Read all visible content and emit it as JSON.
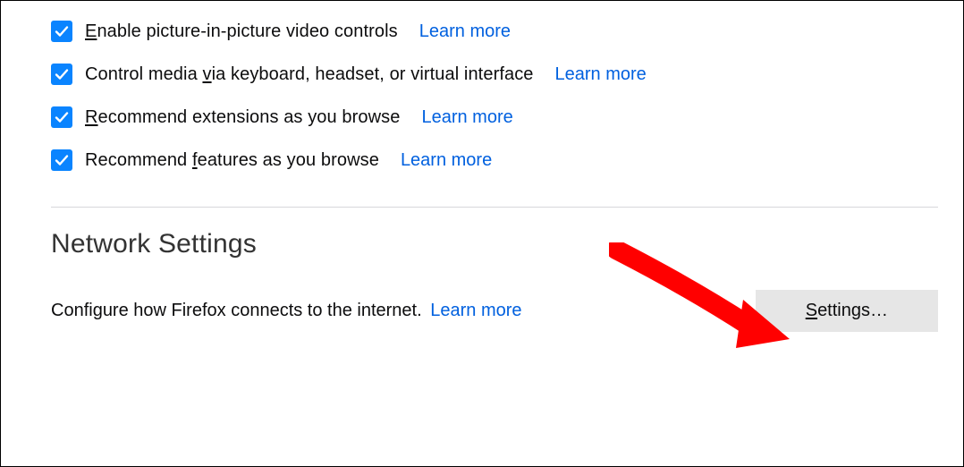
{
  "browsing": {
    "options": [
      {
        "pre": "",
        "accel": "E",
        "post": "nable picture-in-picture video controls",
        "learn_more": "Learn more"
      },
      {
        "pre": "Control media ",
        "accel": "v",
        "post": "ia keyboard, headset, or virtual interface",
        "learn_more": "Learn more"
      },
      {
        "pre": "",
        "accel": "R",
        "post": "ecommend extensions as you browse",
        "learn_more": "Learn more"
      },
      {
        "pre": "Recommend ",
        "accel": "f",
        "post": "eatures as you browse",
        "learn_more": "Learn more"
      }
    ]
  },
  "network": {
    "heading": "Network Settings",
    "description": "Configure how Firefox connects to the internet.",
    "learn_more": "Learn more",
    "button_pre": "",
    "button_accel": "S",
    "button_post": "ettings…"
  }
}
